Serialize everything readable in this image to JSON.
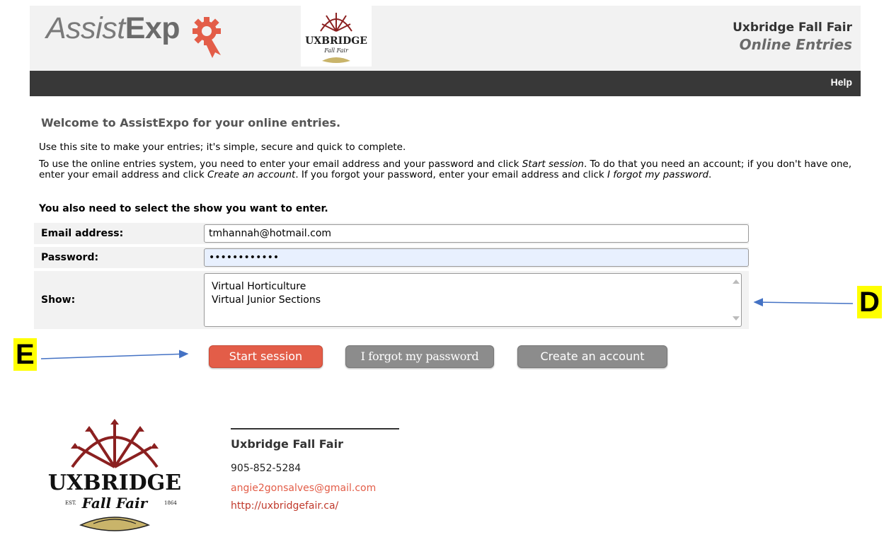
{
  "header": {
    "brand_italic": "Assist",
    "brand_bold": "Exp",
    "fair_name": "Uxbridge Fall Fair",
    "fair_subtitle": "Online Entries"
  },
  "nav": {
    "help_label": "Help"
  },
  "intro": {
    "welcome": "Welcome to AssistExpo for your online entries.",
    "line1": "Use this site to make your entries; it's simple, secure and quick to complete.",
    "line2_a": "To use the online entries system, you need to enter your email address and your password and click ",
    "line2_start": "Start session",
    "line2_b": ". To do that you need an account; if you don't have one, enter your email address and click ",
    "line2_create": "Create an account",
    "line2_c": ". If you forgot your password, enter your email address and click ",
    "line2_forgot": "I forgot my password",
    "line2_d": ".",
    "line3": "You also need to select the show you want to enter."
  },
  "form": {
    "email_label": "Email address:",
    "email_value": "tmhannah@hotmail.com",
    "password_label": "Password:",
    "password_value": "••••••••••••",
    "show_label": "Show:",
    "show_options": [
      "Virtual Horticulture",
      "Virtual Junior Sections"
    ]
  },
  "buttons": {
    "start": "Start session",
    "forgot": "I forgot my password",
    "create": "Create an account"
  },
  "annotations": {
    "d": "D",
    "e": "E"
  },
  "footer": {
    "name": "Uxbridge Fall Fair",
    "phone": "905-852-5284",
    "email": "angie2gonsalves@gmail.com",
    "website": "http://uxbridgefair.ca/"
  },
  "logo": {
    "title": "UXBRIDGE",
    "est": "EST.",
    "script": "Fall Fair",
    "year": "1864"
  },
  "colors": {
    "accent": "#e35d48",
    "nav": "#383838",
    "button_gray": "#8c8c8c",
    "callout": "#ffff00"
  }
}
